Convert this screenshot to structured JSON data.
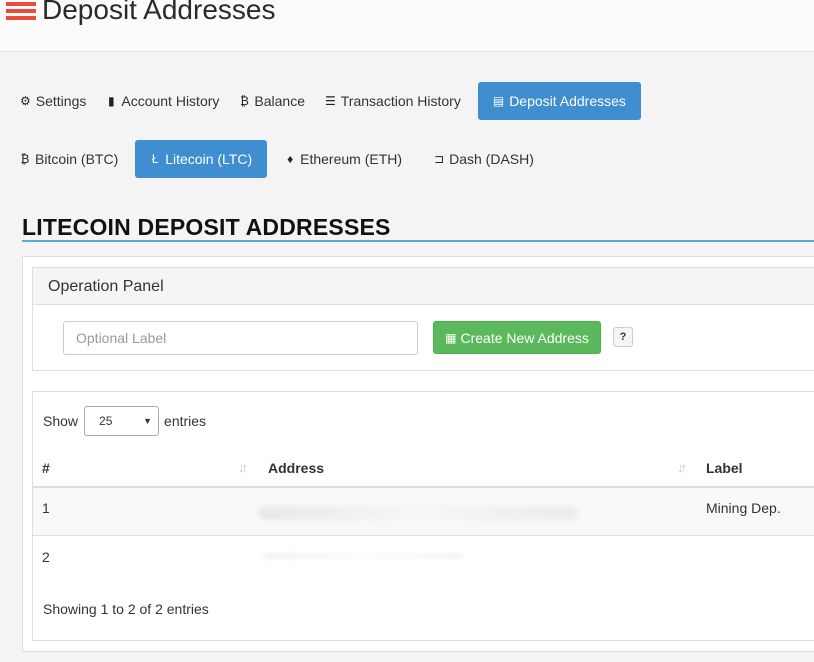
{
  "page": {
    "title": "Deposit Addresses",
    "title_icon": "list-icon",
    "accent_color": "#3e8ed0"
  },
  "nav": {
    "items": [
      {
        "label": "Settings",
        "icon": "gear-icon",
        "glyph": "⚙",
        "active": false
      },
      {
        "label": "Account History",
        "icon": "book-icon",
        "glyph": "▮",
        "active": false
      },
      {
        "label": "Balance",
        "icon": "bitcoin-icon",
        "glyph": "₿",
        "active": false
      },
      {
        "label": "Transaction History",
        "icon": "list-icon",
        "glyph": "☰",
        "active": false
      },
      {
        "label": "Deposit Addresses",
        "icon": "list-alt-icon",
        "glyph": "▤",
        "active": true
      }
    ]
  },
  "currency_tabs": {
    "items": [
      {
        "label": "Bitcoin (BTC)",
        "icon": "bitcoin-icon",
        "glyph": "₿",
        "active": false
      },
      {
        "label": "Litecoin (LTC)",
        "icon": "litecoin-icon",
        "glyph": "Ł",
        "active": true
      },
      {
        "label": "Ethereum (ETH)",
        "icon": "ethereum-icon",
        "glyph": "♦",
        "active": false
      },
      {
        "label": "Dash (DASH)",
        "icon": "dash-icon",
        "glyph": "⊐",
        "active": false
      }
    ]
  },
  "section": {
    "heading": "LITECOIN DEPOSIT ADDRESSES"
  },
  "operation_panel": {
    "title": "Operation Panel",
    "label_placeholder": "Optional Label",
    "create_button": "Create New Address",
    "create_icon_glyph": "▦",
    "help_label": "?",
    "button_color": "#5cb85c"
  },
  "table": {
    "show_label": "Show",
    "entries_label": "entries",
    "page_size": "25",
    "columns": [
      "#",
      "Address",
      "Label"
    ],
    "rows": [
      {
        "index": "1",
        "label": "Mining Dep."
      },
      {
        "index": "2",
        "label": ""
      }
    ],
    "info": "Showing 1 to 2 of 2 entries"
  }
}
